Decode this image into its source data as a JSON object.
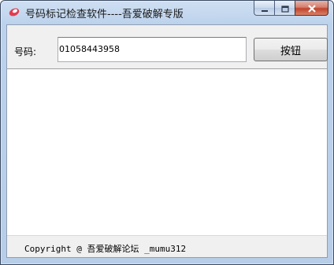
{
  "window": {
    "title": "号码标记检查软件----吾爱破解专版"
  },
  "form": {
    "label": "号码:",
    "phone_value": "01058443958",
    "button_label": "按钮"
  },
  "footer": {
    "text": "Copyright @ 吾爱破解论坛 _mumu312"
  },
  "icons": {
    "app": "app-logo-icon",
    "minimize": "minimize-icon",
    "maximize": "maximize-icon",
    "close": "close-icon"
  },
  "colors": {
    "title_bar": "#bcd2ec",
    "close_button": "#c0432d",
    "client_bg": "#f0f0f0"
  }
}
